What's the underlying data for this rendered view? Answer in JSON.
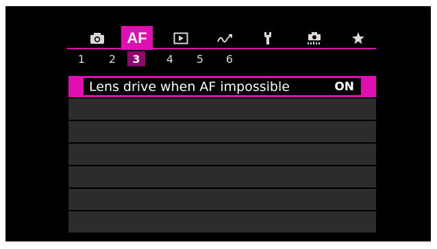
{
  "tabs": [
    {
      "icon": "camera-icon",
      "label": ""
    },
    {
      "icon": "",
      "label": "AF"
    },
    {
      "icon": "playback-icon",
      "label": ""
    },
    {
      "icon": "wireless-icon",
      "label": ""
    },
    {
      "icon": "wrench-icon",
      "label": ""
    },
    {
      "icon": "custom-function-icon",
      "label": ""
    },
    {
      "icon": "star-icon",
      "label": ""
    }
  ],
  "active_tab": "AF",
  "pages": [
    "1",
    "2",
    "3",
    "4",
    "5",
    "6"
  ],
  "active_page": "3",
  "menu": {
    "items": [
      {
        "label": "Lens drive when AF impossible",
        "value": "ON",
        "selected": true
      },
      {
        "label": "",
        "value": ""
      },
      {
        "label": "",
        "value": ""
      },
      {
        "label": "",
        "value": ""
      },
      {
        "label": "",
        "value": ""
      },
      {
        "label": "",
        "value": ""
      },
      {
        "label": "",
        "value": ""
      }
    ]
  },
  "colors": {
    "accent": "#e00fb2",
    "page_active": "#8a0a6e",
    "row_bg": "#2c2c2c",
    "background": "#000000"
  }
}
